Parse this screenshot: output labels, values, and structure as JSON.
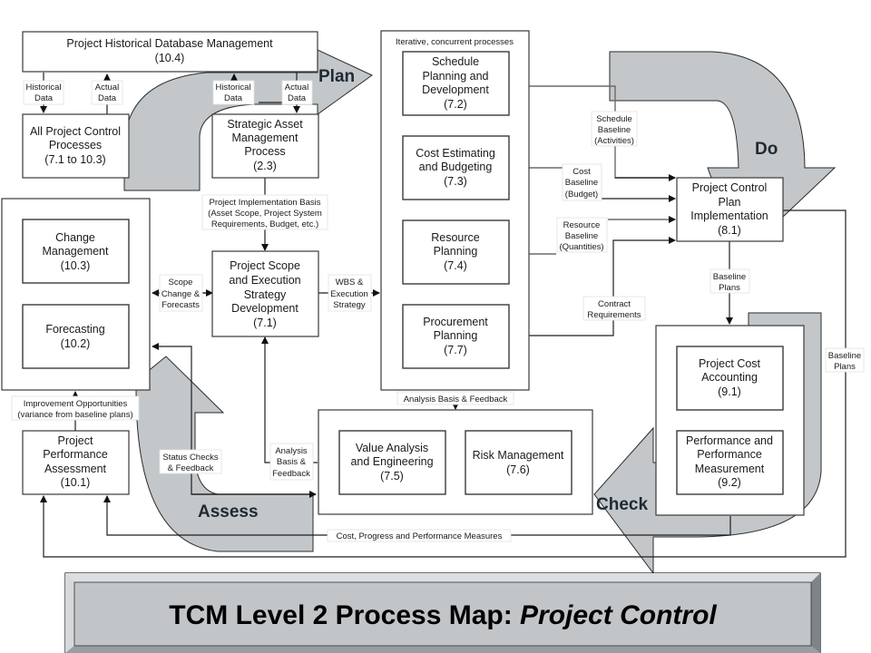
{
  "title": {
    "prefix": "TCM Level 2 Process Map: ",
    "emphasis": "Project Control"
  },
  "phases": {
    "plan": "Plan",
    "do": "Do",
    "check": "Check",
    "assess": "Assess"
  },
  "colors": {
    "flow_arrow": "#c3c7ca",
    "banner": "#c2c5c8",
    "line": "#1e1e1e"
  },
  "groups": {
    "iterative_caption": "Iterative, concurrent processes"
  },
  "nodes": {
    "historical_db": [
      "Project Historical Database Management",
      "(10.4)"
    ],
    "all_processes": [
      "All Project Control",
      "Processes",
      "(7.1 to 10.3)"
    ],
    "strategic_asset": [
      "Strategic Asset",
      "Management",
      "Process",
      "(2.3)"
    ],
    "change_mgmt": [
      "Change",
      "Management",
      "(10.3)"
    ],
    "forecasting": [
      "Forecasting",
      "(10.2)"
    ],
    "scope_exec": [
      "Project Scope",
      "and Execution",
      "Strategy",
      "Development",
      "(7.1)"
    ],
    "schedule": [
      "Schedule",
      "Planning  and",
      "Development",
      "(7.2)"
    ],
    "cost_est": [
      "Cost Estimating",
      "and Budgeting",
      "(7.3)"
    ],
    "resource": [
      "Resource",
      "Planning",
      "(7.4)"
    ],
    "procurement": [
      "Procurement",
      "Planning",
      "(7.7)"
    ],
    "pcp_impl": [
      "Project Control",
      "Plan",
      "Implementation",
      "(8.1)"
    ],
    "cost_acct": [
      "Project Cost",
      "Accounting",
      "(9.1)"
    ],
    "perf_meas": [
      "Performance and",
      "Performance",
      "Measurement",
      "(9.2)"
    ],
    "value_analysis": [
      "Value Analysis",
      "and Engineering",
      "(7.5)"
    ],
    "risk_mgmt": [
      "Risk Management",
      "(7.6)"
    ],
    "perf_assess": [
      "Project",
      "Performance",
      "Assessment",
      "(10.1)"
    ]
  },
  "labels": {
    "historical_data_1": [
      "Historical",
      "Data"
    ],
    "actual_data_1": [
      "Actual",
      "Data"
    ],
    "historical_data_2": [
      "Historical",
      "Data"
    ],
    "actual_data_2": [
      "Actual",
      "Data"
    ],
    "impl_basis": [
      "Project Implementation Basis",
      "(Asset Scope, Project System",
      "Requirements, Budget, etc.)"
    ],
    "scope_change": [
      "Scope",
      "Change &",
      "Forecasts"
    ],
    "wbs": [
      "WBS &",
      "Execution",
      "Strategy"
    ],
    "schedule_baseline": [
      "Schedule",
      "Baseline",
      "(Activities)"
    ],
    "cost_baseline": [
      "Cost",
      "Baseline",
      "(Budget)"
    ],
    "resource_baseline": [
      "Resource",
      "Baseline",
      "(Quantities)"
    ],
    "contract_req": [
      "Contract",
      "Requirements"
    ],
    "baseline_plans_1": [
      "Baseline",
      "Plans"
    ],
    "baseline_plans_2": [
      "Baseline",
      "Plans"
    ],
    "analysis_basis_top": [
      "Analysis Basis & Feedback"
    ],
    "analysis_basis_left": [
      "Analysis",
      "Basis &",
      "Feedback"
    ],
    "improvement": [
      "Improvement Opportunities",
      "(variance from baseline plans)"
    ],
    "status_checks": [
      "Status Checks",
      "& Feedback"
    ],
    "cost_progress": [
      "Cost, Progress and Performance Measures"
    ]
  }
}
